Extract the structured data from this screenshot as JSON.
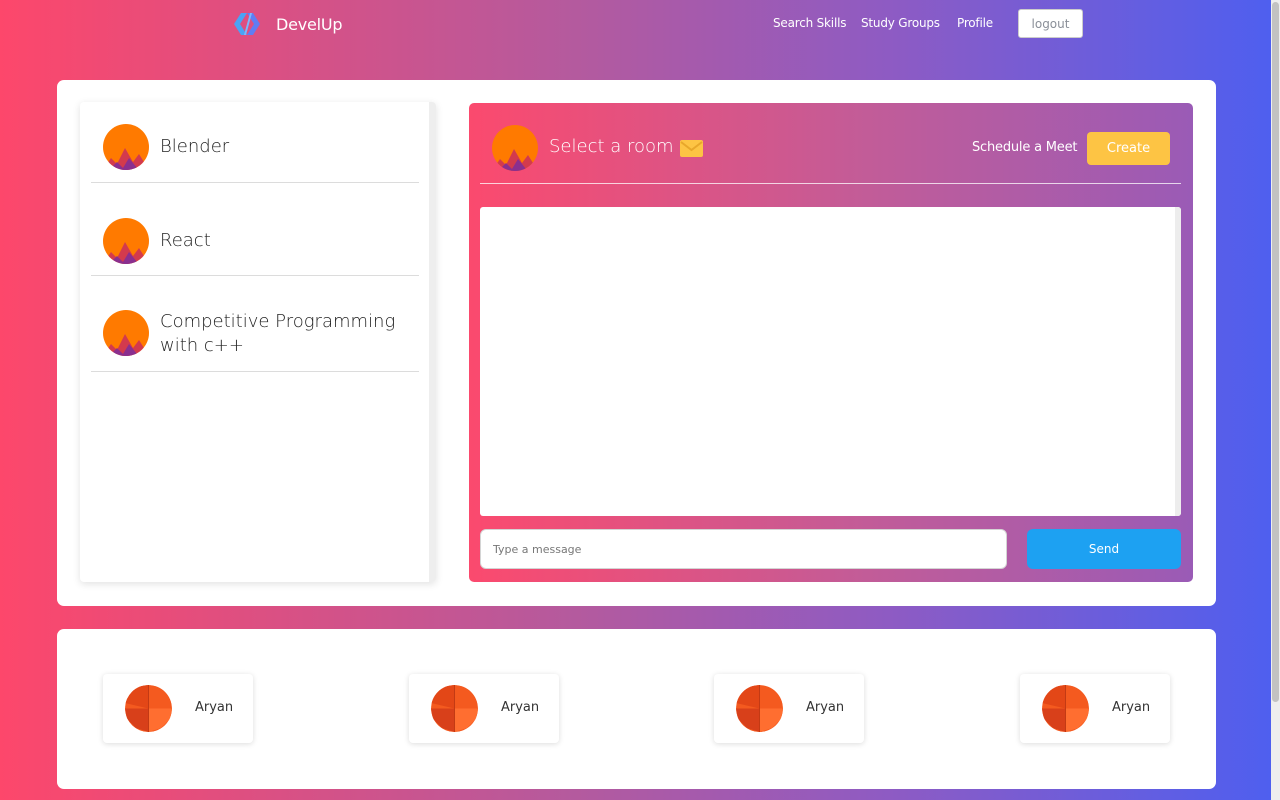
{
  "nav": {
    "brand": "DevelUp",
    "links": [
      "Search Skills",
      "Study Groups",
      "Profile"
    ],
    "logout_label": "logout"
  },
  "rooms": [
    {
      "name": "Blender"
    },
    {
      "name": "React"
    },
    {
      "name": "Competitive Programming with c++"
    }
  ],
  "chat": {
    "title": "Select a room",
    "schedule_label": "Schedule a Meet",
    "create_label": "Create",
    "message_placeholder": "Type a message",
    "message_value": "",
    "send_label": "Send"
  },
  "members": [
    {
      "name": "Aryan"
    },
    {
      "name": "Aryan"
    },
    {
      "name": "Aryan"
    },
    {
      "name": "Aryan"
    }
  ],
  "icons": {
    "brand": "develup-logo-icon",
    "mail": "envelope-icon",
    "room_avatar": "mountain-sunset-avatar-icon",
    "member_avatar": "orange-pie-avatar-icon"
  },
  "colors": {
    "gradient_start": "#fd476b",
    "gradient_end": "#4d5ff0",
    "create_button": "#fdc444",
    "send_button": "#1da1f2",
    "avatar_orange": "#ff7a00"
  }
}
